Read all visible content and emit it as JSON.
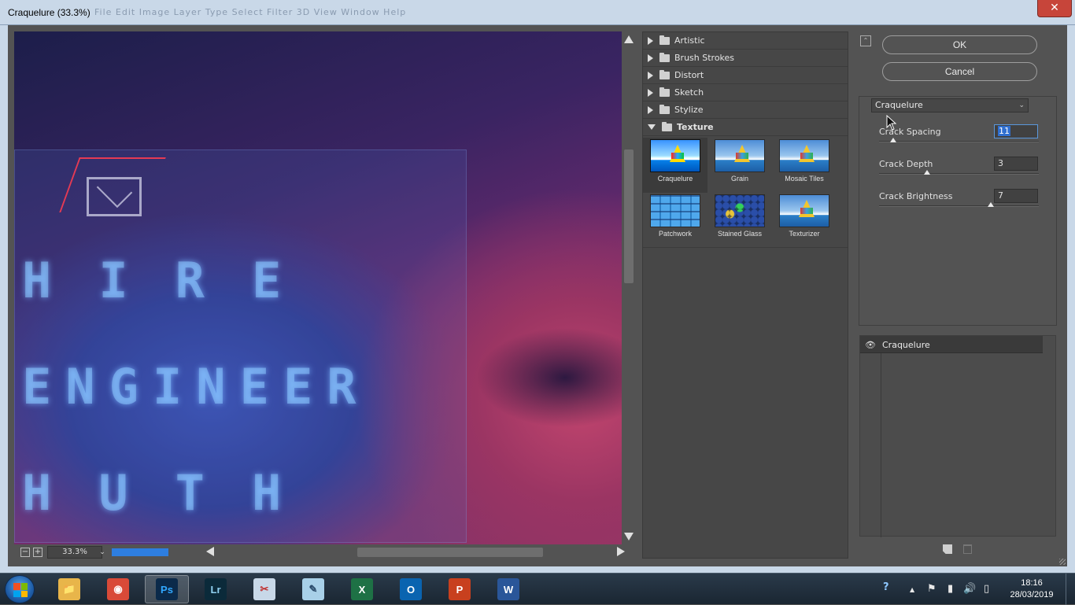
{
  "window": {
    "title": "Craquelure (33.3%)",
    "background_menu": "File   Edit   Image   Layer   Type   Select   Filter   3D   View   Window   Help",
    "close_glyph": "✕"
  },
  "preview": {
    "glow_rows": [
      "HIRE",
      "ENGINEER",
      "HUTH"
    ]
  },
  "bottombar": {
    "zoom_minus": "−",
    "zoom_plus": "+",
    "zoom_value": "33.3%",
    "zoom_dropdown": "⌄",
    "progress": 1.0
  },
  "gallery": {
    "categories": [
      {
        "label": "Artistic",
        "open": false
      },
      {
        "label": "Brush Strokes",
        "open": false
      },
      {
        "label": "Distort",
        "open": false
      },
      {
        "label": "Sketch",
        "open": false
      },
      {
        "label": "Stylize",
        "open": false
      },
      {
        "label": "Texture",
        "open": true
      }
    ],
    "texture_filters": [
      {
        "label": "Craquelure",
        "selected": true
      },
      {
        "label": "Grain",
        "selected": false
      },
      {
        "label": "Mosaic Tiles",
        "selected": false
      },
      {
        "label": "Patchwork",
        "selected": false
      },
      {
        "label": "Stained Glass",
        "selected": false
      },
      {
        "label": "Texturizer",
        "selected": false
      }
    ]
  },
  "panel": {
    "collapse_glyph": "⌃",
    "ok_label": "OK",
    "cancel_label": "Cancel",
    "filter_select": "Craquelure",
    "filter_select_chev": "⌄",
    "params": [
      {
        "label": "Crack Spacing",
        "value": "11",
        "slider": 0.09
      },
      {
        "label": "Crack Depth",
        "value": "3",
        "slider": 0.3
      },
      {
        "label": "Crack Brightness",
        "value": "7",
        "slider": 0.7
      }
    ],
    "layer": {
      "eye": "👁",
      "name": "Craquelure"
    }
  },
  "taskbar": {
    "apps": [
      {
        "name": "Windows Explorer",
        "glyph": "📁",
        "color": "#e8b54a"
      },
      {
        "name": "Google Chrome",
        "glyph": "◉",
        "color": "#d94a38"
      },
      {
        "name": "Photoshop",
        "glyph": "Ps",
        "color": "#0b2a4a",
        "fg": "#31a8ff",
        "active": true
      },
      {
        "name": "Lightroom",
        "glyph": "Lr",
        "color": "#0b2a3a",
        "fg": "#8fd0f0"
      },
      {
        "name": "Snipping Tool",
        "glyph": "✂",
        "color": "#c8d8e8",
        "fg": "#c03030"
      },
      {
        "name": "Notepad",
        "glyph": "✎",
        "color": "#a8d0e8",
        "fg": "#2a4a6a"
      },
      {
        "name": "Excel",
        "glyph": "X",
        "color": "#1e7145",
        "fg": "#ffffff"
      },
      {
        "name": "Outlook",
        "glyph": "O",
        "color": "#0a64b0",
        "fg": "#ffffff"
      },
      {
        "name": "PowerPoint",
        "glyph": "P",
        "color": "#c8401e",
        "fg": "#ffffff"
      },
      {
        "name": "Word",
        "glyph": "W",
        "color": "#2a5699",
        "fg": "#ffffff"
      }
    ],
    "tray": {
      "help": "?",
      "up": "▲",
      "flag": "⚑",
      "signal": "▮",
      "volume": "🔊",
      "battery": "▯"
    },
    "time": "18:16",
    "date": "28/03/2019"
  }
}
